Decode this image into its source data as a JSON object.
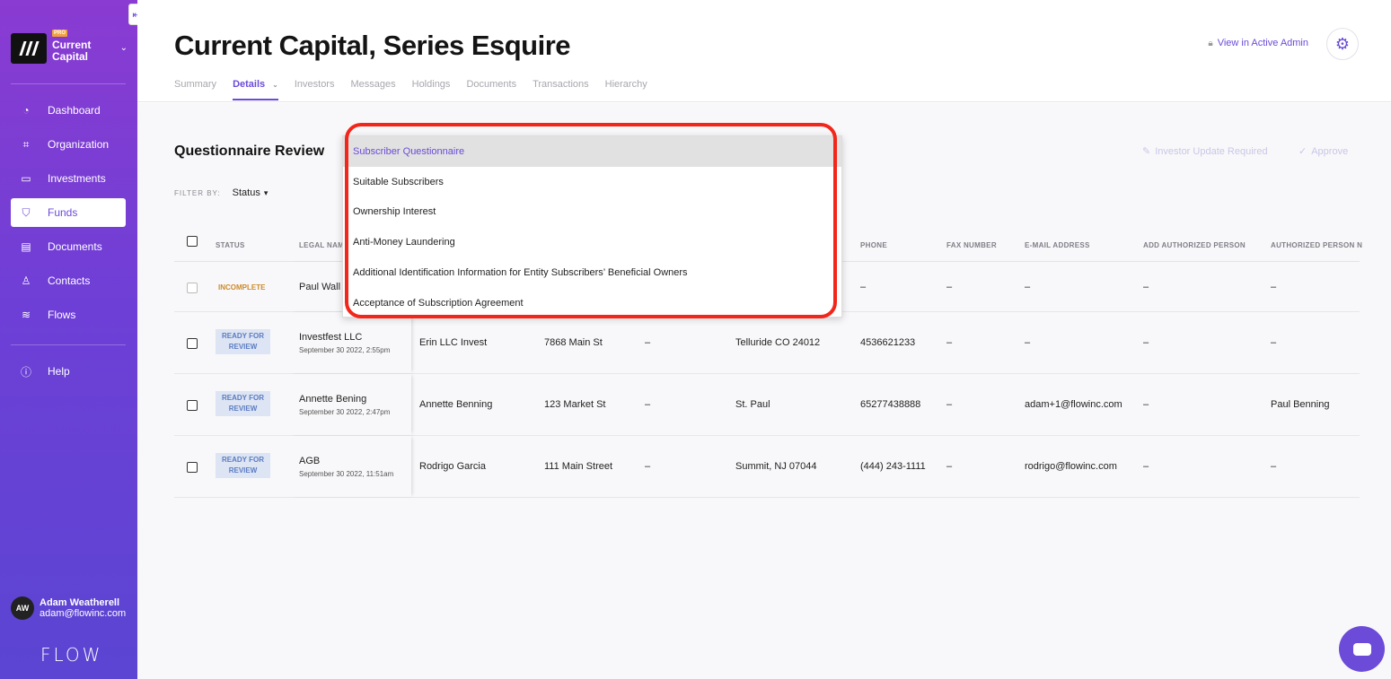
{
  "sidebar": {
    "collapse_icon": "collapse-left-icon",
    "org": {
      "badge": "PRO",
      "name_line1": "Current",
      "name_line2": "Capital"
    },
    "nav": [
      {
        "label": "Dashboard",
        "icon": "dashboard-icon"
      },
      {
        "label": "Organization",
        "icon": "organization-icon"
      },
      {
        "label": "Investments",
        "icon": "briefcase-icon"
      },
      {
        "label": "Funds",
        "icon": "shield-icon"
      },
      {
        "label": "Documents",
        "icon": "document-icon"
      },
      {
        "label": "Contacts",
        "icon": "person-icon"
      },
      {
        "label": "Flows",
        "icon": "layers-icon"
      }
    ],
    "help": "Help",
    "user": {
      "initials": "AW",
      "name": "Adam Weatherell",
      "email": "adam@flowinc.com"
    },
    "logo_text": "FLOW"
  },
  "header": {
    "title": "Current Capital, Series Esquire",
    "tabs": [
      "Summary",
      "Details",
      "Investors",
      "Messages",
      "Holdings",
      "Documents",
      "Transactions",
      "Hierarchy"
    ],
    "active_tab": "Details",
    "admin_link": "View in Active Admin"
  },
  "main": {
    "section_title": "Questionnaire Review",
    "filter_label": "FILTER BY:",
    "filter_value": "Status",
    "actions": {
      "investor_update": "Investor Update Required",
      "approve": "Approve"
    },
    "columns": {
      "status": "STATUS",
      "legal_name": "LEGAL NAM",
      "phone": "PHONE",
      "fax": "FAX NUMBER",
      "email": "E-MAIL ADDRESS",
      "add_authorized": "ADD AUTHORIZED PERSON",
      "authorized": "AUTHORIZED PERSON N"
    },
    "rows": [
      {
        "status": "INCOMPLETE",
        "legal_name": "Paul Wall",
        "date": "",
        "col_a": "",
        "col_b": "",
        "col_c": "",
        "col_d": "",
        "phone": "–",
        "fax": "–",
        "email": "–",
        "add_auth": "–",
        "auth": "–"
      },
      {
        "status": "READY FOR REVIEW",
        "legal_name": "Investfest LLC",
        "date": "September 30 2022, 2:55pm",
        "col_a": "Erin LLC Invest",
        "col_b": "7868 Main St",
        "col_c": "–",
        "col_d": "Telluride CO 24012",
        "phone": "4536621233",
        "fax": "–",
        "email": "–",
        "add_auth": "–",
        "auth": "–"
      },
      {
        "status": "READY FOR REVIEW",
        "legal_name": "Annette Bening",
        "date": "September 30 2022, 2:47pm",
        "col_a": "Annette Benning",
        "col_b": "123 Market St",
        "col_c": "–",
        "col_d": "St. Paul",
        "phone": "65277438888",
        "fax": "–",
        "email": "adam+1@flowinc.com",
        "add_auth": "–",
        "auth": "Paul Benning"
      },
      {
        "status": "READY FOR REVIEW",
        "legal_name": "AGB",
        "date": "September 30 2022, 11:51am",
        "col_a": "Rodrigo Garcia",
        "col_b": "111 Main Street",
        "col_c": "–",
        "col_d": "Summit, NJ 07044",
        "phone": "(444) 243-1111",
        "fax": "–",
        "email": "rodrigo@flowinc.com",
        "add_auth": "–",
        "auth": "–"
      }
    ]
  },
  "dropdown": {
    "options": [
      "Subscriber Questionnaire",
      "Suitable Subscribers",
      "Ownership Interest",
      "Anti-Money Laundering",
      "Additional Identification Information for Entity Subscribers’ Beneficial Owners",
      "Acceptance of Subscription Agreement"
    ],
    "selected": "Subscriber Questionnaire"
  },
  "colors": {
    "accent": "#6b4bd8",
    "highlight": "#f2261a",
    "incomplete": "#cc8a2a"
  }
}
